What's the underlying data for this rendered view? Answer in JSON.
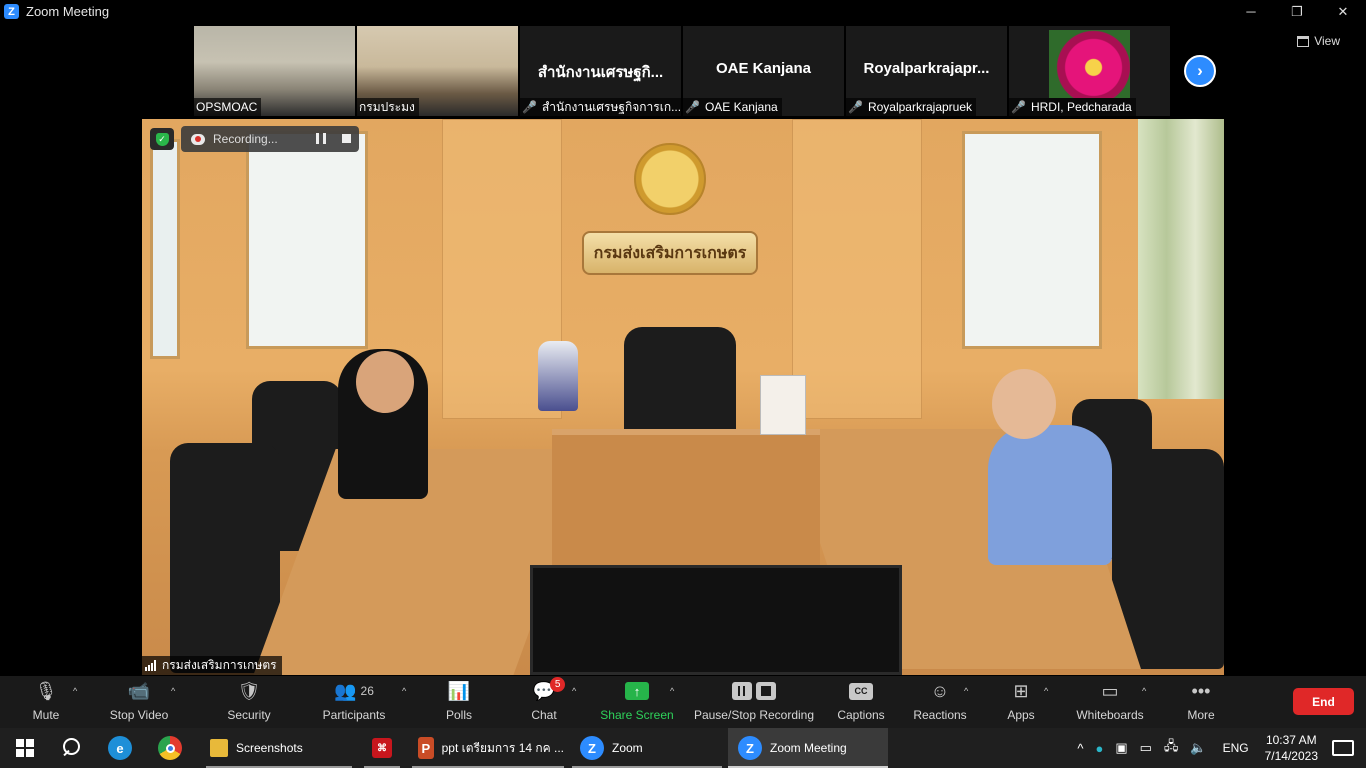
{
  "window": {
    "title": "Zoom Meeting",
    "controls": [
      "─",
      "❐",
      "✕"
    ]
  },
  "gallery": {
    "tiles": [
      {
        "name": "OPSMOAC",
        "big": "",
        "muted": false
      },
      {
        "name": "กรมประมง",
        "big": "",
        "muted": false
      },
      {
        "name": "สำนักงานเศรษฐกิจการเก...",
        "big": "สำนักงานเศรษฐกิ...",
        "muted": true
      },
      {
        "name": "OAE Kanjana",
        "big": "OAE Kanjana",
        "muted": true
      },
      {
        "name": "Royalparkrajapruek",
        "big": "Royalparkrajapr...",
        "muted": true
      },
      {
        "name": "HRDI, Pedcharada",
        "big": "",
        "muted": true
      }
    ],
    "next": "›",
    "view_label": "View"
  },
  "main_video": {
    "plaque_text": "กรมส่งเสริมการเกษตร",
    "speaker_name": "กรมส่งเสริมการเกษตร",
    "recording_label": "Recording..."
  },
  "toolbar": {
    "mute": "Mute",
    "stop_video": "Stop Video",
    "security": "Security",
    "participants": "Participants",
    "participants_count": "26",
    "polls": "Polls",
    "chat": "Chat",
    "chat_badge": "5",
    "share_screen": "Share Screen",
    "pause_stop_recording": "Pause/Stop Recording",
    "captions": "Captions",
    "captions_icon": "CC",
    "reactions": "Reactions",
    "apps": "Apps",
    "whiteboards": "Whiteboards",
    "more": "More",
    "end": "End"
  },
  "taskbar": {
    "apps": [
      {
        "label": "Screenshots"
      },
      {
        "label": ""
      },
      {
        "label": "ppt เตรียมการ 14 กค ..."
      },
      {
        "label": "Zoom"
      },
      {
        "label": "Zoom Meeting"
      }
    ],
    "lang": "ENG",
    "time": "10:37 AM",
    "date": "7/14/2023"
  }
}
